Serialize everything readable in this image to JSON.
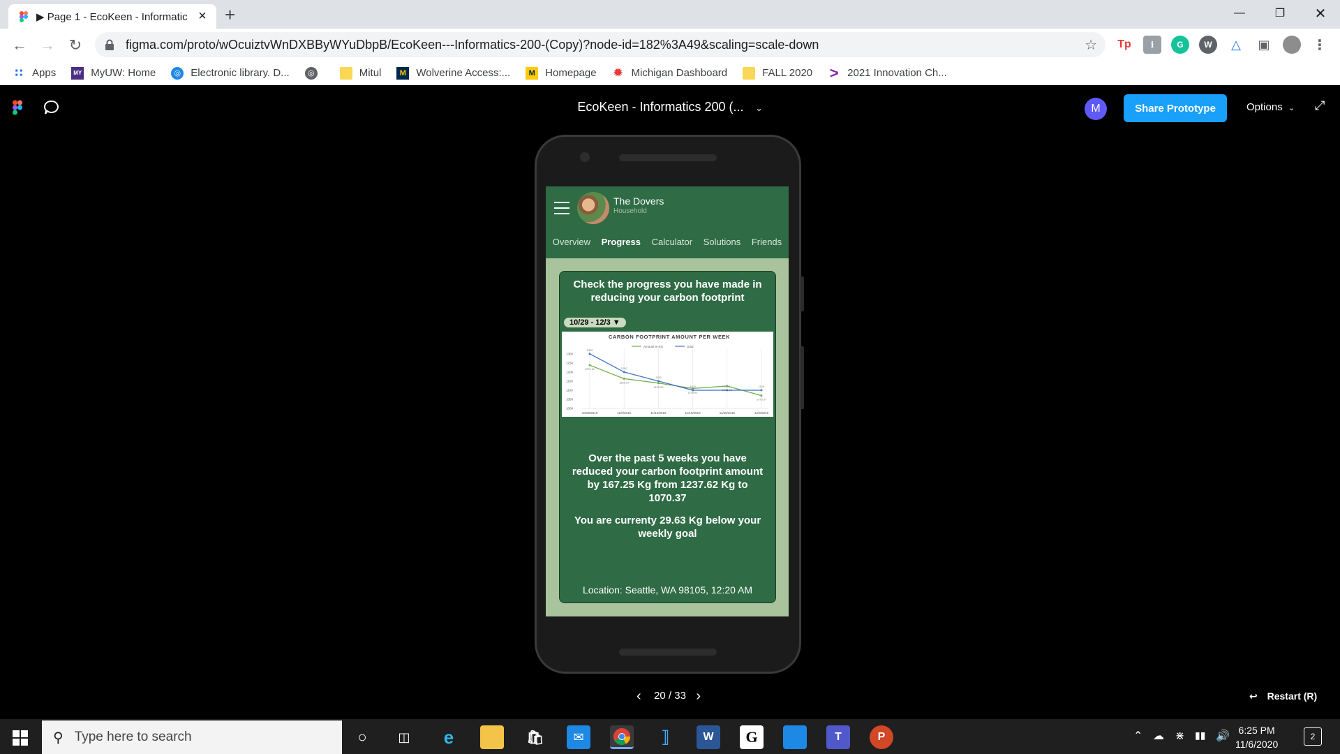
{
  "browser": {
    "tab_title": "▶ Page 1 - EcoKeen - Informatic",
    "url": "figma.com/proto/wOcuiztvWnDXBByWYuDbpB/EcoKeen---Informatics-200-(Copy)?node-id=182%3A49&scaling=scale-down",
    "bookmarks": [
      {
        "label": "Apps",
        "icon": "apps-grid-icon"
      },
      {
        "label": "MyUW: Home",
        "icon": "myuw-icon"
      },
      {
        "label": "Electronic library. D...",
        "icon": "globe-icon"
      },
      {
        "label": "",
        "icon": "globe-dark-icon"
      },
      {
        "label": "Mitul",
        "icon": "folder-icon"
      },
      {
        "label": "Wolverine Access:...",
        "icon": "michigan-m-icon"
      },
      {
        "label": "Homepage",
        "icon": "michigan-m-icon"
      },
      {
        "label": "Michigan Dashboard",
        "icon": "gear-red-icon"
      },
      {
        "label": "FALL 2020",
        "icon": "folder-icon"
      },
      {
        "label": "2021 Innovation Ch...",
        "icon": "purple-chevron-icon"
      }
    ]
  },
  "figma": {
    "doc_title": "EcoKeen - Informatics 200 (...",
    "avatar_letter": "M",
    "share_label": "Share Prototype",
    "options_label": "Options",
    "page_indicator": "20 / 33",
    "restart_label": "Restart (R)"
  },
  "app": {
    "household_name": "The Dovers",
    "household_sub": "Household",
    "tabs": [
      "Overview",
      "Progress",
      "Calculator",
      "Solutions",
      "Friends"
    ],
    "active_tab": "Progress",
    "heading": "Check the progress you have made in reducing your carbon footprint",
    "date_range": "10/29 - 12/3 ▼",
    "summary_prefix": "Over the past 5 weeks you have reduced your carbon footprint amount by",
    "summary_amount": "167.25 Kg",
    "summary_suffix": "from 1237.62 Kg to 1070.37",
    "goal_prefix": "You are currenty",
    "goal_amount": "29.63 Kg below",
    "goal_suffix": "your weekly goal",
    "location": "Location: Seattle, WA  98105,  12:20 AM"
  },
  "chart_data": {
    "type": "line",
    "title": "CARBON FOOTPRINT AMOUNT PER WEEK",
    "categories": [
      "10/29/2019",
      "11/5/2019",
      "11/12/2019",
      "11/19/2019",
      "11/26/2019",
      "12/3/2019"
    ],
    "series": [
      {
        "name": "Amount in KG",
        "color": "#70ad47",
        "values": [
          1237.62,
          1163.37,
          1138.95,
          1109.81,
          1123.12,
          1070.37
        ]
      },
      {
        "name": "Goal",
        "color": "#4472c4",
        "values": [
          1300,
          1200,
          1150,
          1100,
          1100,
          1100
        ]
      }
    ],
    "y_ticks": [
      "1000",
      "1050",
      "1100",
      "1150",
      "1200",
      "1250",
      "1300"
    ],
    "ylim": [
      1000,
      1330
    ]
  },
  "taskbar": {
    "search_placeholder": "Type here to search",
    "time": "6:25 PM",
    "date": "11/6/2020",
    "notification_count": "2"
  }
}
